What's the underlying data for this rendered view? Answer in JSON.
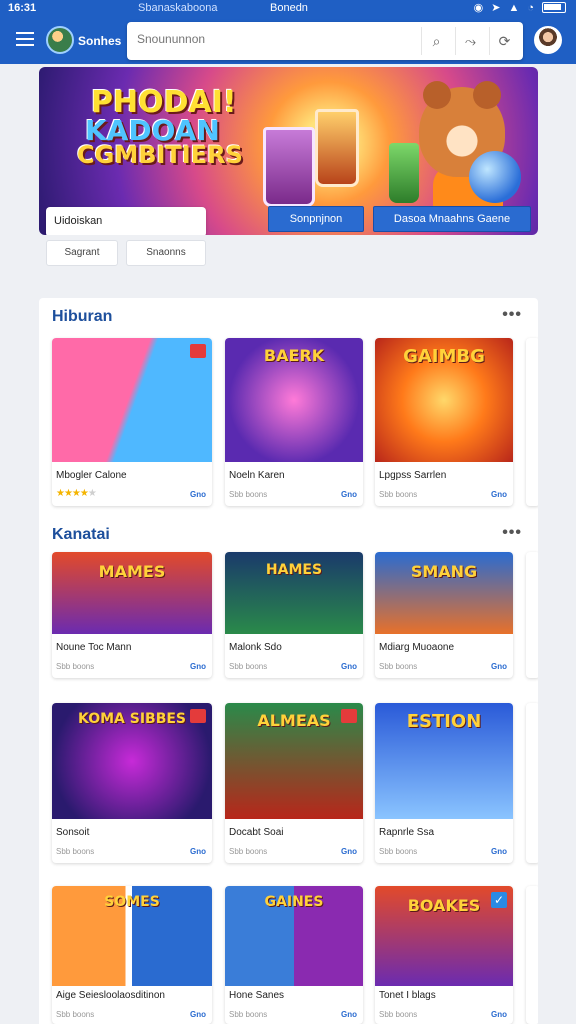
{
  "status_bar": {
    "time": "16:31",
    "tab_url": "Sbanaskaboona",
    "tab_label": "Bonedn"
  },
  "app_bar": {
    "app_name": "Sonhes",
    "search_placeholder": "Snoununnon"
  },
  "hero": {
    "title_lines": [
      "PHODAI!",
      "KADOAN",
      "CGMBITIERS"
    ],
    "card_label": "Uidoiskan",
    "btn_primary": "Sonpnjnon",
    "btn_secondary": "Dasoa Mnaahns Gaene",
    "chips": [
      "Sagrant",
      "Snaonns"
    ]
  },
  "sections": [
    {
      "title": "Hiburan",
      "cards": [
        {
          "name": "Mbogler Calone",
          "sub": "",
          "rating": 4,
          "action": "Gno",
          "thumb": [
            "#ff6aa8",
            "#4fb8ff"
          ],
          "overlay": ""
        },
        {
          "name": "Noeln Karen",
          "sub": "Sbb boons",
          "rating": 0,
          "action": "Gno",
          "thumb": [
            "#5a2ab0",
            "#c7268a"
          ],
          "overlay": "BAERK"
        },
        {
          "name": "Lpgpss Sarrlen",
          "sub": "Sbb boons",
          "rating": 0,
          "action": "Gno",
          "thumb": [
            "#ff7a1a",
            "#b8261a"
          ],
          "overlay": "GAIMBG"
        }
      ]
    },
    {
      "title": "Kanatai",
      "cards": [
        {
          "name": "Noune Toc Mann",
          "sub": "Sbb boons",
          "action": "Gno",
          "thumb": [
            "#e24a2a",
            "#6b2bb0"
          ],
          "overlay": "MAMES"
        },
        {
          "name": "Malonk Sdo",
          "sub": "Sbb boons",
          "action": "Gno",
          "thumb": [
            "#1a3a6b",
            "#2a8a4a"
          ],
          "overlay": "HAMES"
        },
        {
          "name": "Mdiarg Muoaone",
          "sub": "Sbb boons",
          "action": "Gno",
          "thumb": [
            "#2a6bd0",
            "#e8712a"
          ],
          "overlay": "SMANG"
        },
        {
          "name": "Sonsoit",
          "sub": "Sbb boons",
          "action": "Gno",
          "thumb": [
            "#6b2bb0",
            "#2a1a6e"
          ],
          "overlay": "KOMA SIBBES"
        },
        {
          "name": "Docabt Soai",
          "sub": "Sbb boons",
          "action": "Gno",
          "thumb": [
            "#2a8a4a",
            "#b8261a"
          ],
          "overlay": "ALMEAS"
        },
        {
          "name": "Rapnrle Ssa",
          "sub": "Sbb boons",
          "action": "Gno",
          "thumb": [
            "#2a5ad8",
            "#8ac4ff"
          ],
          "overlay": "ESTION"
        },
        {
          "name": "Aige Seiesloolaosditinon",
          "sub": "Sbb boons",
          "action": "Gno",
          "thumb": [
            "#ff9a3c",
            "#2a6bd0"
          ],
          "overlay": "SOMES"
        },
        {
          "name": "Hone Sanes",
          "sub": "Sbb boons",
          "action": "Gno",
          "thumb": [
            "#3a7dd8",
            "#8a2ab0"
          ],
          "overlay": "GAINES"
        },
        {
          "name": "Tonet I blags",
          "sub": "Sbb boons",
          "action": "Gno",
          "thumb": [
            "#e24a2a",
            "#6b2bb0"
          ],
          "overlay": "BOAKES"
        }
      ]
    }
  ],
  "colors": {
    "primary": "#1f5fc4",
    "accent": "#2a6bd0",
    "section_title": "#1d4f9c",
    "star": "#f4b400"
  },
  "icons": [
    "menu-icon",
    "search-icon",
    "share-icon",
    "settings-icon",
    "avatar",
    "wifi-icon",
    "battery-icon"
  ]
}
